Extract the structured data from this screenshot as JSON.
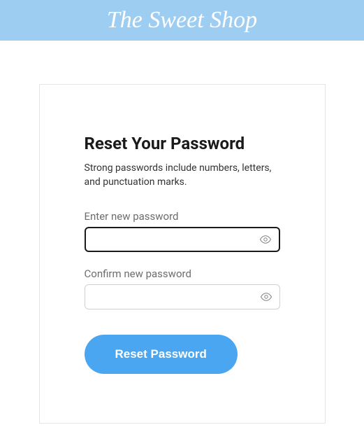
{
  "header": {
    "logo": "The Sweet Shop"
  },
  "form": {
    "title": "Reset Your Password",
    "subtitle": "Strong passwords include numbers, letters, and punctuation marks.",
    "new_password": {
      "label": "Enter new password",
      "value": ""
    },
    "confirm_password": {
      "label": "Confirm new password",
      "value": ""
    },
    "submit_label": "Reset Password"
  }
}
